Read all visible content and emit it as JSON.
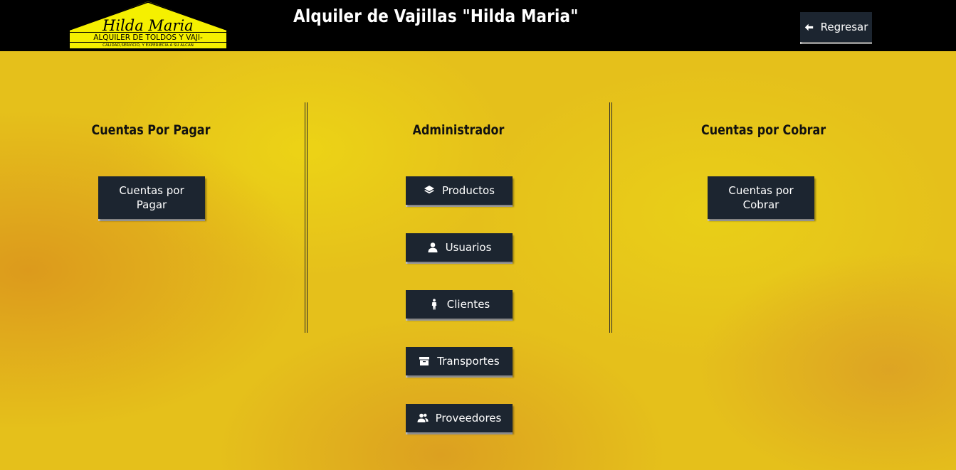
{
  "header": {
    "title": "Alquiler de Vajillas \"Hilda Maria\"",
    "back_label": "Regresar",
    "logo": {
      "name": "Hilda Maria",
      "line1": "ALQUILER DE TOLDOS Y VAJI-",
      "line2": "CALIDAD,SERVICIO, Y EXPERIECIA A SU ALCAN"
    }
  },
  "left": {
    "title": "Cuentas Por Pagar",
    "button_label": "Cuentas por Pagar"
  },
  "center": {
    "title": "Administrador",
    "buttons": [
      {
        "label": "Productos",
        "icon": "layers-icon"
      },
      {
        "label": "Usuarios",
        "icon": "user-icon"
      },
      {
        "label": "Clientes",
        "icon": "person-standing-icon"
      },
      {
        "label": "Transportes",
        "icon": "archive-box-icon"
      },
      {
        "label": "Proveedores",
        "icon": "users-icon"
      }
    ]
  },
  "right": {
    "title": "Cuentas por Cobrar",
    "button_label": "Cuentas por Cobrar"
  },
  "colors": {
    "topbar": "#000000",
    "button": "#1c2530",
    "background": "#e5c01b",
    "logo_yellow": "#f5f000"
  }
}
